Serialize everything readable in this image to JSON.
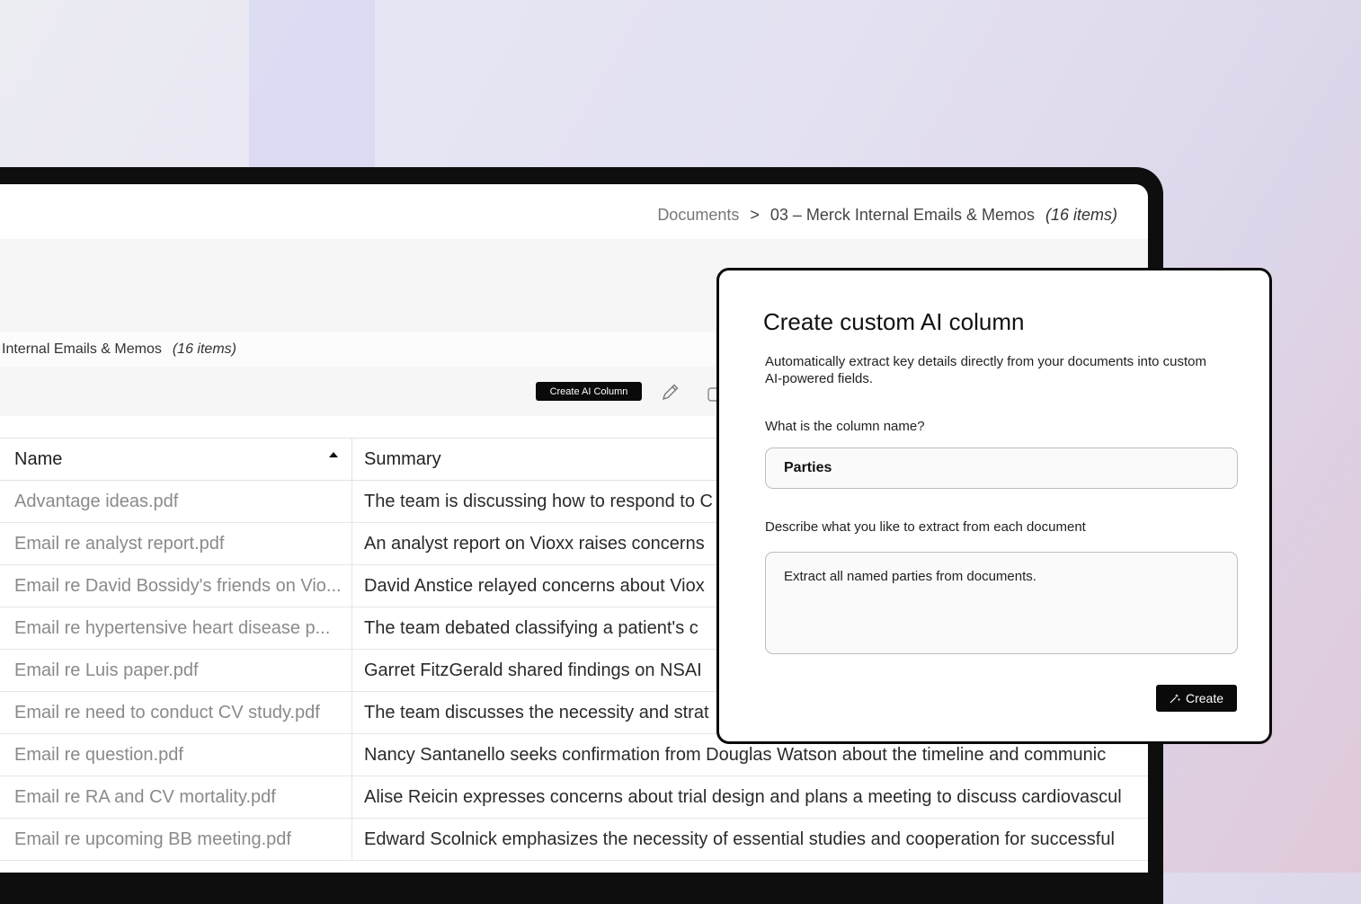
{
  "breadcrumb": {
    "root": "Documents",
    "separator": ">",
    "current": "03 – Merck Internal Emails & Memos",
    "count": "(16 items)"
  },
  "folder": {
    "title": "Internal Emails & Memos",
    "count": "(16 items)"
  },
  "toolbar": {
    "create_ai_column_label": "Create AI Column",
    "icons": [
      "pencil-icon",
      "cut-icon"
    ]
  },
  "table": {
    "columns": [
      "Name",
      "Summary"
    ],
    "sort": "ascending",
    "rows": [
      {
        "name": "Advantage ideas.pdf",
        "summary": "The team is discussing how to respond to C"
      },
      {
        "name": "Email re analyst report.pdf",
        "summary": "An analyst report on Vioxx raises concerns"
      },
      {
        "name": "Email re David Bossidy's friends on Vio...",
        "summary": "David Anstice relayed concerns about Viox"
      },
      {
        "name": "Email re hypertensive heart disease p...",
        "summary": "The team debated classifying a patient's c"
      },
      {
        "name": "Email re Luis paper.pdf",
        "summary": "Garret FitzGerald shared findings on NSAI"
      },
      {
        "name": "Email re need to conduct CV study.pdf",
        "summary": "The team discusses the necessity and strat"
      },
      {
        "name": "Email re question.pdf",
        "summary": "Nancy Santanello seeks confirmation from Douglas Watson about the timeline and communic"
      },
      {
        "name": "Email re RA and CV mortality.pdf",
        "summary": "Alise Reicin expresses concerns about trial design and plans a meeting to discuss cardiovascul"
      },
      {
        "name": "Email re upcoming BB meeting.pdf",
        "summary": "Edward Scolnick emphasizes the necessity of essential studies and cooperation for successful"
      }
    ]
  },
  "modal": {
    "title": "Create custom AI column",
    "description": "Automatically extract key details directly from your documents into custom AI-powered fields.",
    "name_label": "What is the column name?",
    "name_value": "Parties",
    "extract_label": "Describe what you like to extract from each document",
    "extract_value": "Extract all named parties from documents.",
    "create_label": "Create"
  },
  "colors": {
    "button_bg": "#0a0a0a",
    "frame": "#0e0e0e",
    "name_text": "#8a8a8a"
  }
}
